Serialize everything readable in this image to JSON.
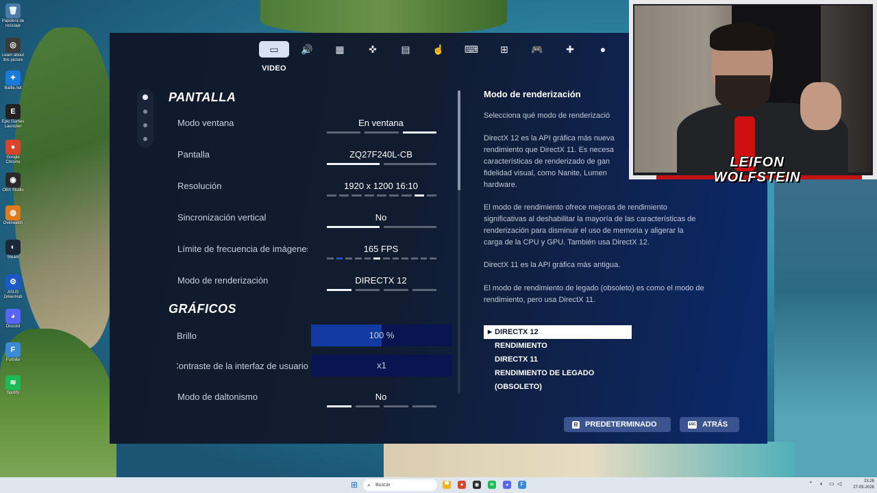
{
  "desktop": {
    "icons": [
      {
        "label": "Papelera de reciclaje",
        "icon": "recycle-bin-icon",
        "glyph": "🗑",
        "color": "#4a7aa8"
      },
      {
        "label": "Learn about this picture",
        "icon": "info-icon",
        "glyph": "◎",
        "color": "#3a3a3a"
      },
      {
        "label": "Battle.net",
        "icon": "battlenet-icon",
        "glyph": "✦",
        "color": "#1a7ad8"
      },
      {
        "label": "Epic Games Launcher",
        "icon": "epic-icon",
        "glyph": "E",
        "color": "#222"
      },
      {
        "label": "Google Chrome",
        "icon": "chrome-icon",
        "glyph": "●",
        "color": "#d8452b"
      },
      {
        "label": "OBS Studio",
        "icon": "obs-icon",
        "glyph": "◉",
        "color": "#2a2a2a"
      },
      {
        "label": "Overwatch",
        "icon": "overwatch-icon",
        "glyph": "◍",
        "color": "#e07a1a"
      },
      {
        "label": "Steam",
        "icon": "steam-icon",
        "glyph": "◐",
        "color": "#1b2838"
      },
      {
        "label": "ASUS DriverHub",
        "icon": "asus-icon",
        "glyph": "⚙",
        "color": "#1a5ac8"
      },
      {
        "label": "Discord",
        "icon": "discord-icon",
        "glyph": "◕",
        "color": "#5865f2"
      },
      {
        "label": "Fortnite",
        "icon": "fortnite-icon",
        "glyph": "F",
        "color": "#3a8ad8"
      },
      {
        "label": "Spotify",
        "icon": "spotify-icon",
        "glyph": "≋",
        "color": "#1db954"
      }
    ]
  },
  "game": {
    "tabs": [
      {
        "icon": "monitor-icon",
        "glyph": "▭",
        "active": true
      },
      {
        "icon": "speaker-icon",
        "glyph": "🔊",
        "active": false
      },
      {
        "icon": "accessibility-icon",
        "glyph": "▦",
        "active": false
      },
      {
        "icon": "gamepad-touch-icon",
        "glyph": "✜",
        "active": false
      },
      {
        "icon": "hud-icon",
        "glyph": "▤",
        "active": false
      },
      {
        "icon": "pointer-icon",
        "glyph": "☝",
        "active": false
      },
      {
        "icon": "mouse-keyboard-icon",
        "glyph": "⌨",
        "active": false
      },
      {
        "icon": "network-icon",
        "glyph": "⊞",
        "active": false
      },
      {
        "icon": "controller-icon",
        "glyph": "🎮",
        "active": false
      },
      {
        "icon": "dpad-icon",
        "glyph": "✚",
        "active": false
      },
      {
        "icon": "account-icon",
        "glyph": "●",
        "active": false
      }
    ],
    "active_tab_label": "VIDEO",
    "sections": {
      "display_title": "PANTALLA",
      "graphics_title": "GRÁFICOS"
    },
    "settings": [
      {
        "label": "Modo ventana",
        "value": "En ventana",
        "bars": [
          0,
          0,
          1
        ],
        "kind": "bars"
      },
      {
        "label": "Pantalla",
        "value": "ZQ27F240L-CB",
        "bars": [
          1,
          0
        ],
        "kind": "bars"
      },
      {
        "label": "Resolución",
        "value": "1920 x 1200 16:10",
        "bars": [
          0,
          0,
          0,
          0,
          0,
          0,
          0,
          1,
          0
        ],
        "kind": "bars"
      },
      {
        "label": "Sincronización vertical",
        "value": "No",
        "bars": [
          1,
          0
        ],
        "kind": "bars"
      },
      {
        "label": "Límite de frecuencia de imágenes",
        "value": "165 FPS",
        "bars": [
          0,
          2,
          0,
          0,
          0,
          1,
          0,
          0,
          0,
          0,
          0,
          0
        ],
        "kind": "bars"
      },
      {
        "label": "Modo de renderización",
        "value": "DIRECTX 12",
        "bars": [
          1,
          0,
          0,
          0
        ],
        "kind": "bars"
      }
    ],
    "graphics": [
      {
        "label": "Brillo",
        "value": "100 %",
        "fill": 0.5,
        "kind": "slider"
      },
      {
        "label": "Contraste de la interfaz de usuario",
        "value": "x1",
        "fill": 0,
        "kind": "slider"
      },
      {
        "label": "Modo de daltonismo",
        "value": "No",
        "bars": [
          1,
          0,
          0,
          0
        ],
        "kind": "bars"
      }
    ],
    "info": {
      "title": "Modo de renderización",
      "paragraphs": [
        "Selecciona qué modo de renderizació",
        "DirectX 12 es la API gráfica más nueva\nrendimiento que DirectX 11. Es necesa\ncaracterísticas de renderizado de gan\nfidelidad visual, como Nanite, Lumen\nhardware.",
        "El modo de rendimiento ofrece mejoras de rendimiento\nsignificativas al deshabilitar la mayoría de las características de\nrenderización para disminuir el uso de memoria y aligerar la\ncarga de la CPU y GPU. También usa DirectX 12.",
        "DirectX 11 es la API gráfica más antigua.",
        "El modo de rendimiento de legado (obsoleto) es como el modo de\nrendimiento, pero usa DirectX 11."
      ]
    },
    "options": [
      "DIRECTX 12",
      "RENDIMIENTO",
      "DIRECTX 11",
      "RENDIMIENTO DE LEGADO (OBSOLETO)"
    ],
    "selected_option": 0,
    "buttons": {
      "default_key": "R",
      "default_label": "PREDETERMINADO",
      "back_key": "ESC",
      "back_label": "ATRÁS"
    }
  },
  "webcam": {
    "logo_line1": "LEIFON",
    "logo_line2": "WOLFSTEIN"
  },
  "taskbar": {
    "search_placeholder": "Buscar",
    "time": "23:28",
    "date": "27-05-2026",
    "apps": [
      {
        "icon": "file-explorer-icon",
        "glyph": "▀",
        "color": "#f2b51a"
      },
      {
        "icon": "chrome-taskbar-icon",
        "glyph": "●",
        "color": "#d8452b"
      },
      {
        "icon": "obs-taskbar-icon",
        "glyph": "◉",
        "color": "#2a2a2a"
      },
      {
        "icon": "spotify-taskbar-icon",
        "glyph": "≋",
        "color": "#1db954"
      },
      {
        "icon": "discord-taskbar-icon",
        "glyph": "◕",
        "color": "#5865f2"
      },
      {
        "icon": "fortnite-taskbar-icon",
        "glyph": "F",
        "color": "#3a8ad8"
      }
    ]
  }
}
